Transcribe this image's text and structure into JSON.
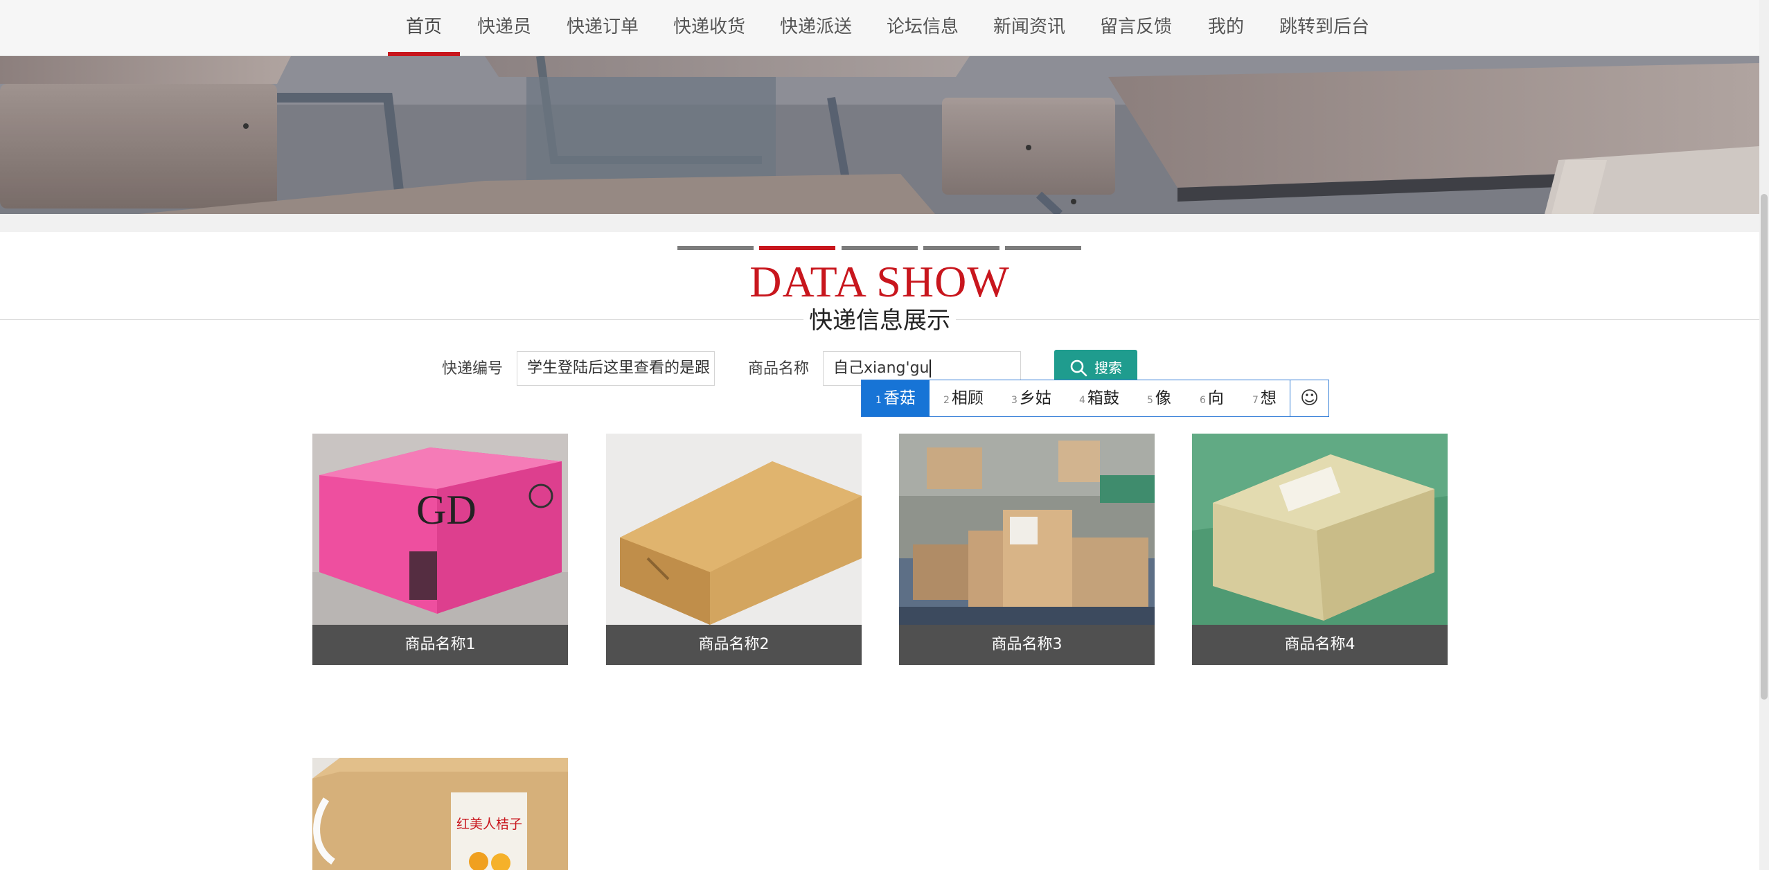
{
  "nav": {
    "items": [
      {
        "label": "首页",
        "active": true
      },
      {
        "label": "快递员"
      },
      {
        "label": "快递订单"
      },
      {
        "label": "快递收货"
      },
      {
        "label": "快递派送"
      },
      {
        "label": "论坛信息"
      },
      {
        "label": "新闻资讯"
      },
      {
        "label": "留言反馈"
      },
      {
        "label": "我的"
      },
      {
        "label": "跳转到后台"
      }
    ]
  },
  "carousel": {
    "count": 5,
    "active_index": 2
  },
  "section": {
    "title_en": "DATA SHOW",
    "title_cn": "快递信息展示"
  },
  "search": {
    "express_no_label": "快递编号",
    "express_no_value": "学生登陆后这里查看的是跟",
    "product_label": "商品名称",
    "product_value": "自己xiang'gu",
    "button_label": "搜索"
  },
  "ime": {
    "candidates": [
      {
        "num": "1",
        "text": "香菇"
      },
      {
        "num": "2",
        "text": "相顾"
      },
      {
        "num": "3",
        "text": "乡姑"
      },
      {
        "num": "4",
        "text": "箱鼓"
      },
      {
        "num": "5",
        "text": "像"
      },
      {
        "num": "6",
        "text": "向"
      },
      {
        "num": "7",
        "text": "想"
      }
    ],
    "emoji_icon": "smiley-icon"
  },
  "products": [
    {
      "name": "商品名称1",
      "image": "pink-box"
    },
    {
      "name": "商品名称2",
      "image": "flat-kraft-box"
    },
    {
      "name": "商品名称3",
      "image": "parcel-pile"
    },
    {
      "name": "商品名称4",
      "image": "taped-box"
    },
    {
      "name": "",
      "image": "fruit-gift-box",
      "label_text": "红美人桔子"
    }
  ],
  "colors": {
    "accent": "#c8161d",
    "button": "#1f9c8e",
    "ime_selected": "#1774d6",
    "caption_bg": "#505050"
  }
}
